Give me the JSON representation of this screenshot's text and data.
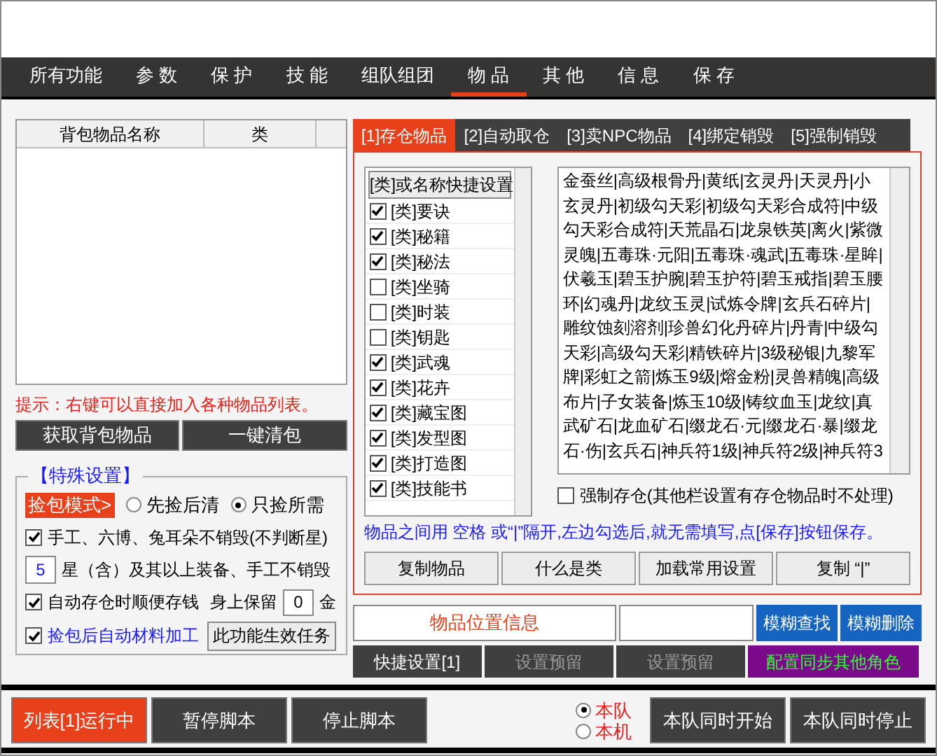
{
  "nav_tabs": [
    {
      "label": "所有功能",
      "selected": false
    },
    {
      "label": "参 数",
      "selected": false
    },
    {
      "label": "保 护",
      "selected": false
    },
    {
      "label": "技 能",
      "selected": false
    },
    {
      "label": "组队组团",
      "selected": false
    },
    {
      "label": "物 品",
      "selected": true
    },
    {
      "label": "其 他",
      "selected": false
    },
    {
      "label": "信 息",
      "selected": false
    },
    {
      "label": "保 存",
      "selected": false
    }
  ],
  "bag_list": {
    "columns": [
      "背包物品名称",
      "类"
    ]
  },
  "hint": "提示：右键可以直接加入各种物品列表。",
  "bag_buttons": [
    "获取背包物品",
    "一键清包"
  ],
  "special": {
    "title": "【特殊设置】",
    "mode_label": "捡包模式>",
    "mode_options": [
      {
        "label": "先捡后清",
        "selected": false
      },
      {
        "label": "只捡所需",
        "selected": true
      }
    ],
    "no_destroy": {
      "label": "手工、六博、兔耳朵不销毁(不判断星)",
      "checked": true
    },
    "star_value": "5",
    "star_label": "星（含）及其以上装备、手工不销毁",
    "auto_money": {
      "label": "自动存仓时顺便存钱",
      "checked": true
    },
    "keep_label": "身上保留",
    "keep_value": "0",
    "gold_label": "金",
    "auto_process": {
      "label": "捡包后自动材料加工",
      "checked": true
    },
    "task_button": "此功能生效任务"
  },
  "item_tabs": [
    {
      "label": "[1]存仓物品",
      "selected": true
    },
    {
      "label": "[2]自动取仓",
      "selected": false
    },
    {
      "label": "[3]卖NPC物品",
      "selected": false
    },
    {
      "label": "[4]绑定销毁",
      "selected": false
    },
    {
      "label": "[5]强制销毁",
      "selected": false
    }
  ],
  "category_header": "[类]或名称快捷设置",
  "categories": [
    {
      "label": "[类]要诀",
      "checked": true
    },
    {
      "label": "[类]秘籍",
      "checked": true
    },
    {
      "label": "[类]秘法",
      "checked": true
    },
    {
      "label": "[类]坐骑",
      "checked": false
    },
    {
      "label": "[类]时装",
      "checked": false
    },
    {
      "label": "[类]钥匙",
      "checked": false
    },
    {
      "label": "[类]武魂",
      "checked": true
    },
    {
      "label": "[类]花卉",
      "checked": true
    },
    {
      "label": "[类]藏宝图",
      "checked": true
    },
    {
      "label": "[类]发型图",
      "checked": true
    },
    {
      "label": "[类]打造图",
      "checked": true
    },
    {
      "label": "[类]技能书",
      "checked": true
    }
  ],
  "items_text": "金蚕丝|高级根骨丹|黄纸|玄灵丹|天灵丹|小玄灵丹|初级勾天彩|初级勾天彩合成符|中级勾天彩合成符|天荒晶石|龙泉铁英|离火|紫微灵魄|五毒珠·元阳|五毒珠·魂武|五毒珠·星眸|伏羲玉|碧玉护腕|碧玉护符|碧玉戒指|碧玉腰环|幻魂丹|龙纹玉灵|试炼令牌|玄兵石碎片|雕纹蚀刻溶剂|珍兽幻化丹碎片|丹青|中级勾天彩|高级勾天彩|精铁碎片|3级秘银|九黎军牌|彩虹之箭|炼玉9级|熔金粉|灵兽精魄|高级布片|子女装备|炼玉10级|铸纹血玉|龙纹|真武矿石|龙血矿石|缀龙石·元|缀龙石·暴|缀龙石·伤|玄兵石|神兵符1级|神兵符2级|神兵符3",
  "force_store": {
    "label": "强制存仓(其他栏设置有存仓物品时不处理)",
    "checked": false
  },
  "tip": "物品之间用 空格 或“|”隔开,左边勾选后,就无需填写,点[保存]按钮保存。",
  "item_buttons": [
    "复制物品",
    "什么是类",
    "加载常用设置",
    "复制 “|”"
  ],
  "location_label": "物品位置信息",
  "fuzzy_buttons": [
    "模糊查找",
    "模糊删除"
  ],
  "row_buttons": [
    {
      "label": "快捷设置[1]",
      "disabled": false,
      "kind": "dark"
    },
    {
      "label": "设置预留",
      "disabled": true,
      "kind": "dark"
    },
    {
      "label": "设置预留",
      "disabled": true,
      "kind": "dark"
    },
    {
      "label": "配置同步其他角色",
      "disabled": false,
      "kind": "purple"
    }
  ],
  "footer": {
    "run_buttons": [
      {
        "label": "列表[1]运行中",
        "selected": true
      },
      {
        "label": "暂停脚本",
        "selected": false
      },
      {
        "label": "停止脚本",
        "selected": false
      }
    ],
    "scope": [
      {
        "label": "本队",
        "selected": true
      },
      {
        "label": "本机",
        "selected": false
      }
    ],
    "team_buttons": [
      "本队同时开始",
      "本队同时停止"
    ]
  }
}
